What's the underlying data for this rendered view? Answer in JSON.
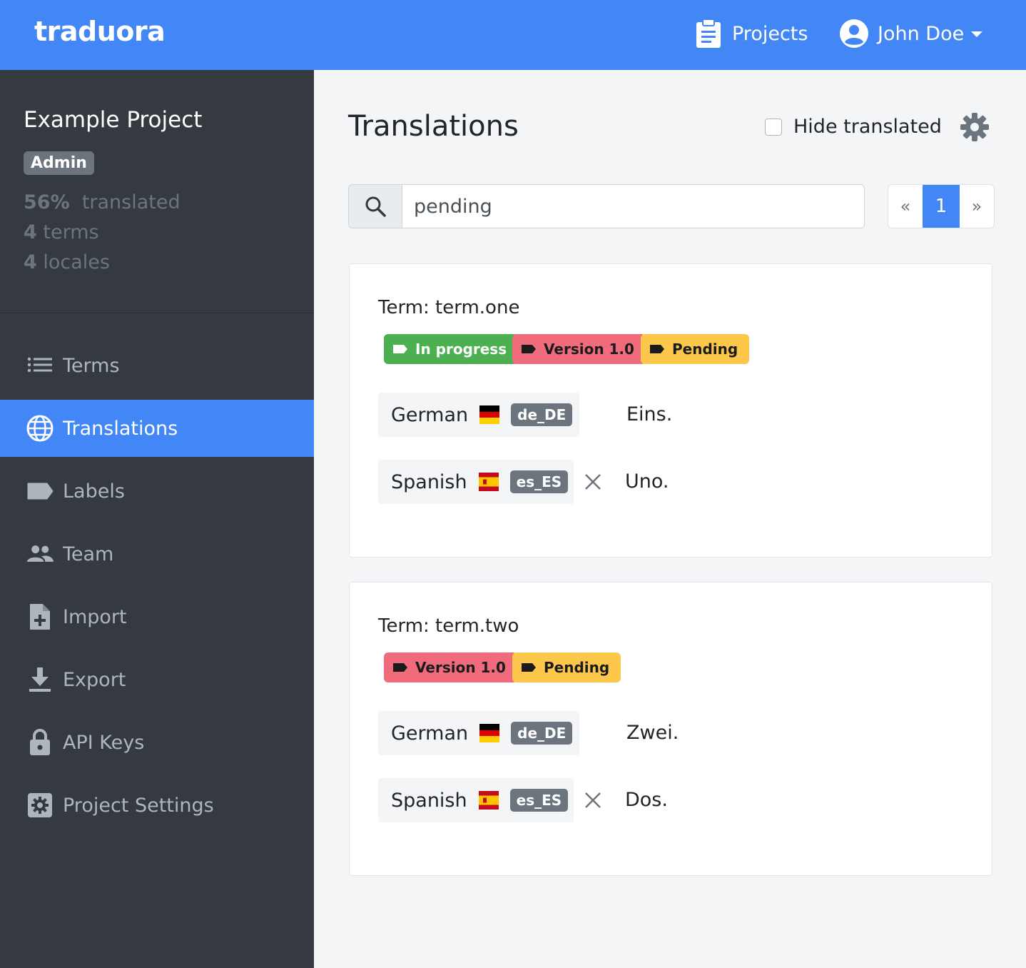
{
  "topbar": {
    "brand": "traduora",
    "projects_label": "Projects",
    "user_name": "John Doe",
    "projects_icon": "clipboard-icon",
    "user_icon": "user-circle-icon"
  },
  "sidebar": {
    "project_name": "Example Project",
    "role": "Admin",
    "stats": {
      "percent": "56%",
      "percent_label": "translated",
      "terms_count": "4",
      "terms_label": "terms",
      "locales_count": "4",
      "locales_label": "locales"
    },
    "items": [
      {
        "label": "Terms",
        "icon": "list-icon"
      },
      {
        "label": "Translations",
        "icon": "globe-icon",
        "active": true
      },
      {
        "label": "Labels",
        "icon": "label-icon"
      },
      {
        "label": "Team",
        "icon": "team-icon"
      },
      {
        "label": "Import",
        "icon": "file-plus-icon"
      },
      {
        "label": "Export",
        "icon": "download-icon"
      },
      {
        "label": "API Keys",
        "icon": "lock-icon"
      },
      {
        "label": "Project Settings",
        "icon": "settings-icon"
      }
    ]
  },
  "main": {
    "title": "Translations",
    "hide_translated_label": "Hide translated",
    "hide_translated_checked": false,
    "search_value": "pending",
    "pager": {
      "prev": "«",
      "current": "1",
      "next": "»"
    },
    "terms": [
      {
        "title": "Term: term.one",
        "labels": [
          {
            "text": "In progress",
            "color": "#4caf50"
          },
          {
            "text": "Version 1.0",
            "color": "#f06b7c"
          },
          {
            "text": "Pending",
            "color": "#fdc74c"
          }
        ],
        "translations": [
          {
            "language": "German",
            "code": "de_DE",
            "text": "Eins.",
            "flag": "de"
          },
          {
            "language": "Spanish",
            "code": "es_ES",
            "text": "Uno.",
            "flag": "es"
          }
        ]
      },
      {
        "title": "Term: term.two",
        "labels": [
          {
            "text": "Version 1.0",
            "color": "#f06b7c"
          },
          {
            "text": "Pending",
            "color": "#fdc74c"
          }
        ],
        "translations": [
          {
            "language": "German",
            "code": "de_DE",
            "text": "Zwei.",
            "flag": "de"
          },
          {
            "language": "Spanish",
            "code": "es_ES",
            "text": "Dos.",
            "flag": "es"
          }
        ]
      }
    ]
  },
  "colors": {
    "primary": "#4287f5",
    "sidebar_bg": "#343a40",
    "page_bg": "#f4f5f7",
    "badge_gray": "#6c757d"
  }
}
